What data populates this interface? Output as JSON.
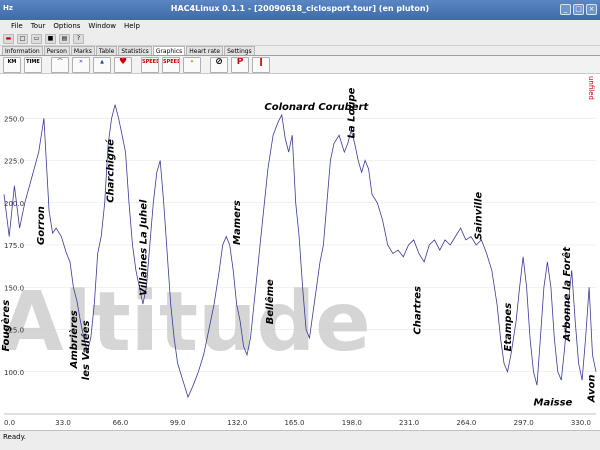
{
  "window": {
    "title": "HAC4Linux 0.1.1 - [20090618_ciclosport.tour] (en pluton)",
    "app_icon_text": "Hz"
  },
  "menu": {
    "items": [
      "File",
      "Tour",
      "Options",
      "Window",
      "Help"
    ]
  },
  "toolbar": {
    "icons": [
      "flag-icon",
      "new-icon",
      "open-icon",
      "save-icon",
      "print-icon",
      "help-pointer-icon"
    ]
  },
  "tabs": {
    "items": [
      "Information",
      "Person",
      "Marks",
      "Table",
      "Statistics",
      "Graphics",
      "Heart rate",
      "Settings"
    ],
    "active": "Graphics"
  },
  "chart_toolbar": {
    "buttons": [
      {
        "name": "km-axis",
        "label": "KM"
      },
      {
        "name": "time-axis",
        "label": "TIME"
      },
      {
        "name": "altitude-profile",
        "label": ""
      },
      {
        "name": "bike",
        "label": ""
      },
      {
        "name": "climb",
        "label": ""
      },
      {
        "name": "heart",
        "label": ""
      },
      {
        "name": "speed",
        "label": "SPEED"
      },
      {
        "name": "speed-avg",
        "label": "SPEED"
      },
      {
        "name": "temperature",
        "label": ""
      },
      {
        "name": "zoom",
        "label": ""
      },
      {
        "name": "pause",
        "label": "P"
      },
      {
        "name": "thermometer",
        "label": ""
      }
    ]
  },
  "status": {
    "text": "Ready."
  },
  "colors": {
    "line": "#3a3a9a",
    "grid": "#e3e3e3",
    "accent": "#c00000"
  },
  "chart_data": {
    "type": "line",
    "title": "",
    "watermark": "Altitude",
    "side_label": "unfiled",
    "xlabel": "",
    "ylabel": "",
    "xlim": [
      0,
      341
    ],
    "ylim": [
      75,
      275
    ],
    "x_ticks": [
      {
        "value": 0,
        "label": "0.0"
      },
      {
        "value": 33,
        "label": "33.0"
      },
      {
        "value": 66,
        "label": "66.0"
      },
      {
        "value": 99,
        "label": "99.0"
      },
      {
        "value": 132,
        "label": "132.0"
      },
      {
        "value": 165,
        "label": "165.0"
      },
      {
        "value": 198,
        "label": "198.0"
      },
      {
        "value": 231,
        "label": "231.0"
      },
      {
        "value": 264,
        "label": "264.0"
      },
      {
        "value": 297,
        "label": "297.0"
      },
      {
        "value": 330,
        "label": "330.0"
      }
    ],
    "y_ticks": [
      {
        "value": 100,
        "label": "100.0"
      },
      {
        "value": 125,
        "label": "125.0"
      },
      {
        "value": 150,
        "label": "150.0"
      },
      {
        "value": 175,
        "label": "175.0"
      },
      {
        "value": 200,
        "label": "200.0"
      },
      {
        "value": 225,
        "label": "225.0"
      },
      {
        "value": 250,
        "label": "250.0"
      }
    ],
    "series": [
      {
        "points": [
          [
            0,
            205
          ],
          [
            3,
            180
          ],
          [
            6,
            210
          ],
          [
            9,
            185
          ],
          [
            12,
            200
          ],
          [
            16,
            215
          ],
          [
            20,
            230
          ],
          [
            23,
            250
          ],
          [
            26,
            195
          ],
          [
            28,
            182
          ],
          [
            30,
            185
          ],
          [
            33,
            180
          ],
          [
            36,
            170
          ],
          [
            38,
            165
          ],
          [
            40,
            150
          ],
          [
            42,
            142
          ],
          [
            44,
            130
          ],
          [
            46,
            120
          ],
          [
            48,
            112
          ],
          [
            50,
            120
          ],
          [
            52,
            140
          ],
          [
            54,
            170
          ],
          [
            56,
            180
          ],
          [
            58,
            200
          ],
          [
            60,
            235
          ],
          [
            62,
            250
          ],
          [
            64,
            258
          ],
          [
            66,
            250
          ],
          [
            68,
            240
          ],
          [
            70,
            230
          ],
          [
            72,
            200
          ],
          [
            74,
            175
          ],
          [
            76,
            160
          ],
          [
            78,
            150
          ],
          [
            80,
            140
          ],
          [
            82,
            150
          ],
          [
            84,
            175
          ],
          [
            86,
            200
          ],
          [
            88,
            218
          ],
          [
            90,
            225
          ],
          [
            92,
            200
          ],
          [
            94,
            170
          ],
          [
            96,
            140
          ],
          [
            98,
            120
          ],
          [
            100,
            105
          ],
          [
            103,
            95
          ],
          [
            106,
            85
          ],
          [
            109,
            92
          ],
          [
            112,
            100
          ],
          [
            115,
            110
          ],
          [
            118,
            125
          ],
          [
            121,
            140
          ],
          [
            124,
            160
          ],
          [
            126,
            175
          ],
          [
            128,
            180
          ],
          [
            130,
            175
          ],
          [
            132,
            160
          ],
          [
            134,
            140
          ],
          [
            136,
            130
          ],
          [
            138,
            115
          ],
          [
            140,
            110
          ],
          [
            142,
            120
          ],
          [
            144,
            140
          ],
          [
            146,
            160
          ],
          [
            148,
            180
          ],
          [
            150,
            200
          ],
          [
            152,
            220
          ],
          [
            155,
            240
          ],
          [
            158,
            248
          ],
          [
            160,
            252
          ],
          [
            162,
            238
          ],
          [
            164,
            230
          ],
          [
            166,
            240
          ],
          [
            168,
            200
          ],
          [
            170,
            180
          ],
          [
            172,
            150
          ],
          [
            174,
            125
          ],
          [
            176,
            120
          ],
          [
            178,
            135
          ],
          [
            180,
            150
          ],
          [
            182,
            165
          ],
          [
            184,
            175
          ],
          [
            186,
            200
          ],
          [
            188,
            225
          ],
          [
            190,
            235
          ],
          [
            193,
            240
          ],
          [
            196,
            230
          ],
          [
            198,
            235
          ],
          [
            200,
            243
          ],
          [
            202,
            235
          ],
          [
            204,
            225
          ],
          [
            206,
            218
          ],
          [
            208,
            225
          ],
          [
            210,
            220
          ],
          [
            212,
            205
          ],
          [
            215,
            200
          ],
          [
            218,
            190
          ],
          [
            221,
            175
          ],
          [
            224,
            170
          ],
          [
            227,
            172
          ],
          [
            230,
            168
          ],
          [
            233,
            175
          ],
          [
            236,
            178
          ],
          [
            239,
            170
          ],
          [
            242,
            165
          ],
          [
            245,
            175
          ],
          [
            248,
            178
          ],
          [
            251,
            172
          ],
          [
            254,
            178
          ],
          [
            257,
            175
          ],
          [
            260,
            180
          ],
          [
            263,
            185
          ],
          [
            266,
            178
          ],
          [
            269,
            180
          ],
          [
            272,
            175
          ],
          [
            275,
            178
          ],
          [
            278,
            170
          ],
          [
            281,
            160
          ],
          [
            284,
            140
          ],
          [
            286,
            120
          ],
          [
            288,
            105
          ],
          [
            290,
            100
          ],
          [
            292,
            110
          ],
          [
            295,
            130
          ],
          [
            297,
            150
          ],
          [
            299,
            168
          ],
          [
            301,
            150
          ],
          [
            303,
            120
          ],
          [
            305,
            100
          ],
          [
            307,
            92
          ],
          [
            309,
            120
          ],
          [
            311,
            150
          ],
          [
            313,
            165
          ],
          [
            315,
            150
          ],
          [
            317,
            120
          ],
          [
            319,
            100
          ],
          [
            321,
            95
          ],
          [
            323,
            115
          ],
          [
            325,
            140
          ],
          [
            327,
            160
          ],
          [
            329,
            130
          ],
          [
            331,
            105
          ],
          [
            333,
            95
          ],
          [
            335,
            120
          ],
          [
            337,
            150
          ],
          [
            339,
            110
          ],
          [
            341,
            100
          ]
        ]
      }
    ],
    "annotations": [
      {
        "text": "Fougères",
        "x": 3,
        "y": 112,
        "rotate": -90
      },
      {
        "text": "Gorron",
        "x": 23,
        "y": 175,
        "rotate": -90
      },
      {
        "text": "Ambrières",
        "x": 42,
        "y": 102,
        "rotate": -90
      },
      {
        "text": "les Vallées",
        "x": 49,
        "y": 95,
        "rotate": -90
      },
      {
        "text": "Charchigné",
        "x": 63,
        "y": 200,
        "rotate": -90
      },
      {
        "text": "Villaines La Juhel",
        "x": 82,
        "y": 145,
        "rotate": -90
      },
      {
        "text": "Mamers",
        "x": 136,
        "y": 175,
        "rotate": -90
      },
      {
        "text": "Bellême",
        "x": 155,
        "y": 128,
        "rotate": -90
      },
      {
        "text": "Colonard Corubert",
        "x": 150,
        "y": 255,
        "rotate": 0
      },
      {
        "text": "La Loupe",
        "x": 202,
        "y": 238,
        "rotate": -90
      },
      {
        "text": "Chartres",
        "x": 240,
        "y": 122,
        "rotate": -90
      },
      {
        "text": "Sainville",
        "x": 275,
        "y": 178,
        "rotate": -90
      },
      {
        "text": "Etampes",
        "x": 292,
        "y": 112,
        "rotate": -90
      },
      {
        "text": "Arbonne la Forêt",
        "x": 326,
        "y": 118,
        "rotate": -90
      },
      {
        "text": "Maisse",
        "x": 305,
        "y": 80,
        "rotate": 0
      },
      {
        "text": "Avon",
        "x": 340,
        "y": 82,
        "rotate": -90
      }
    ]
  }
}
